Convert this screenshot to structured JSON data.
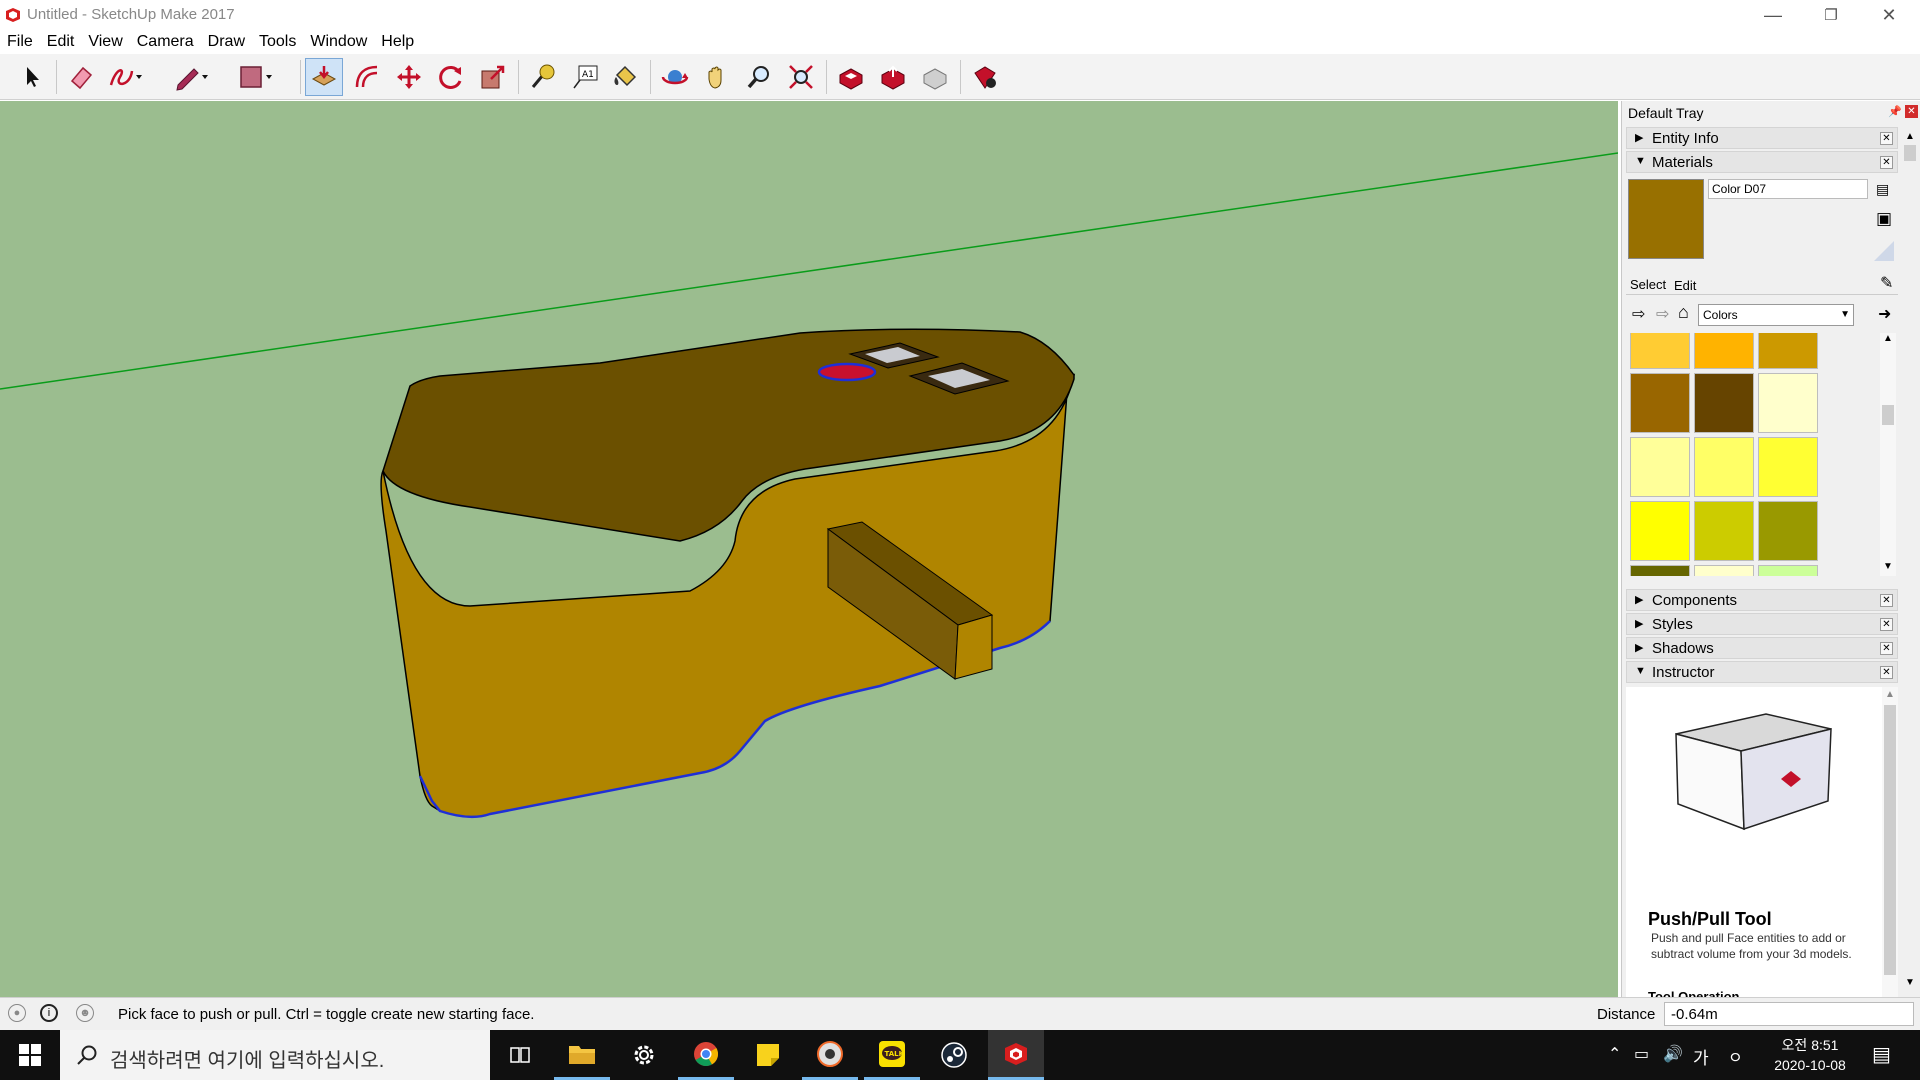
{
  "window": {
    "title": "Untitled - SketchUp Make 2017",
    "controls": [
      "minimize",
      "restore",
      "close"
    ]
  },
  "menu": [
    "File",
    "Edit",
    "View",
    "Camera",
    "Draw",
    "Tools",
    "Window",
    "Help"
  ],
  "toolbar": {
    "tools": [
      "select-tool",
      "eraser-tool",
      "freehand-tool",
      "line-tool",
      "rectangle-tool",
      "push-pull-tool",
      "offset-tool",
      "move-tool",
      "rotate-tool",
      "scale-tool",
      "tape-measure-tool",
      "text-tool",
      "paint-bucket-tool",
      "orbit-tool",
      "pan-tool",
      "zoom-tool",
      "zoom-extents-tool",
      "3d-warehouse-tool",
      "share-model-tool",
      "extension-warehouse-tool",
      "extension-manager-tool"
    ],
    "active": "push-pull-tool"
  },
  "tray": {
    "title": "Default Tray",
    "panels": {
      "entity_info": "Entity Info",
      "materials": "Materials",
      "components": "Components",
      "styles": "Styles",
      "shadows": "Shadows",
      "instructor": "Instructor"
    },
    "materials": {
      "name": "Color D07",
      "preview_color": "#987000",
      "tab_select": "Select",
      "tab_edit": "Edit",
      "library": "Colors",
      "swatches": [
        "#ffcc33",
        "#ffb300",
        "#cc9900",
        "#996600",
        "#664400",
        "#ffffcc",
        "#ffff99",
        "#ffff66",
        "#ffff33",
        "#ffff00",
        "#cccc00",
        "#999900",
        "#666600",
        "#ffffcc",
        "#ccff99"
      ]
    },
    "instructor": {
      "heading": "Push/Pull Tool",
      "body": "Push and pull Face entities to add or subtract volume from your 3d models.",
      "subheading": "Tool Operation"
    }
  },
  "status": {
    "message": "Pick face to push or pull.  Ctrl = toggle create new starting face.",
    "measure_label": "Distance",
    "measure_value": "-0.64m"
  },
  "taskbar": {
    "search_placeholder": "검색하려면 여기에 입력하십시오.",
    "apps": [
      "task-view",
      "file-explorer",
      "settings",
      "chrome",
      "sticky-notes",
      "media-player",
      "kakaotalk",
      "steam",
      "sketchup"
    ],
    "ime": "가",
    "time": "오전 8:51",
    "date": "2020-10-08"
  },
  "colors": {
    "viewport_bg": "#9bbd8f",
    "model_side": "#b08500",
    "model_top": "#6b5000",
    "edge_highlight": "#1f2fd6"
  }
}
